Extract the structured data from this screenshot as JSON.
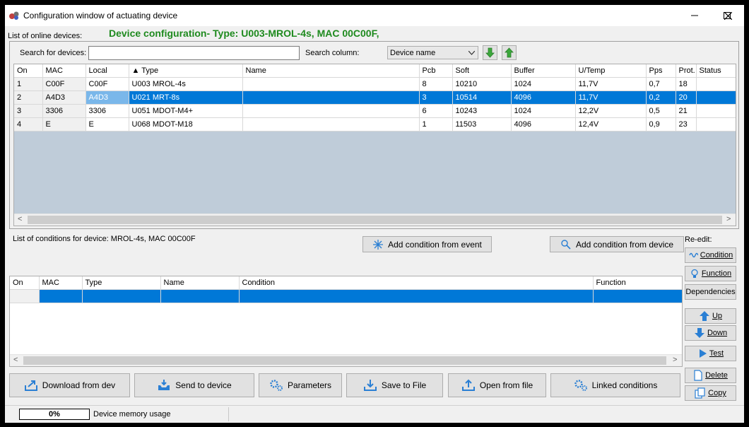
{
  "window": {
    "title": "Configuration window of actuating device",
    "minimize": "—",
    "maximize": "☐",
    "close": "✕"
  },
  "header": {
    "online_devices_label": "List of online devices:",
    "device_configuration": "Device configuration- Type: U003-MROL-4s, MAC 00C00F,"
  },
  "search": {
    "label": "Search for devices:",
    "value": "",
    "column_label": "Search column:",
    "column_value": "Device name"
  },
  "devices_table": {
    "columns": [
      "On",
      "MAC",
      "Local",
      "▲ Type",
      "Name",
      "Pcb",
      "Soft",
      "Buffer",
      "U/Temp",
      "Pps",
      "Prot.",
      "Status"
    ],
    "rows": [
      [
        "1",
        "C00F",
        "C00F",
        "U003 MROL-4s",
        "",
        "8",
        "10210",
        "1024",
        "11,7V",
        "0,7",
        "18",
        ""
      ],
      [
        "2",
        "A4D3",
        "A4D3",
        "U021 MRT-8s",
        "",
        "3",
        "10514",
        "4096",
        "11,7V",
        "0,2",
        "20",
        ""
      ],
      [
        "3",
        "3306",
        "3306",
        "U051 MDOT-M4+",
        "",
        "6",
        "10243",
        "1024",
        "12,2V",
        "0,5",
        "21",
        ""
      ],
      [
        "4",
        "E",
        "E",
        "U068 MDOT-M18",
        "",
        "1",
        "11503",
        "4096",
        "12,4V",
        "0,9",
        "23",
        ""
      ]
    ],
    "selected_row": 1
  },
  "conditions": {
    "list_label": "List of conditions for device: MROL-4s, MAC 00C00F",
    "add_from_event": "Add condition from event",
    "add_from_device": "Add condition from device",
    "columns": [
      "On",
      "MAC",
      "Type",
      "Name",
      "Condition",
      "Function"
    ],
    "rows": [
      [
        "",
        "",
        "",
        "",
        "",
        ""
      ]
    ]
  },
  "side_panel": {
    "re_edit_label": "Re-edit:",
    "condition": "Condition",
    "function": "Function",
    "dependencies": "Dependencies",
    "up": "Up",
    "down": "Down",
    "test": "Test",
    "delete": "Delete",
    "copy": "Copy"
  },
  "bottom_buttons": {
    "download": "Download from dev",
    "send": "Send to device",
    "parameters": "Parameters",
    "save": "Save to File",
    "open": "Open from file",
    "linked": "Linked conditions"
  },
  "status_bar": {
    "progress_text": "0%",
    "progress_value": 0,
    "memory_label": "Device memory usage"
  },
  "colors": {
    "selection": "#0078d7",
    "header_green": "#1e8a1e",
    "arrow_green": "#3ca83c",
    "icon_blue": "#2a7fd4"
  },
  "icons": {
    "app": "gear-app-icon",
    "sort_down": "arrow-down-icon",
    "sort_up": "arrow-up-icon",
    "event": "sparkle-icon",
    "device": "pointer-icon",
    "condition": "wave-icon",
    "function": "bulb-icon",
    "up": "arrow-up-icon",
    "down": "arrow-down-icon",
    "test": "play-icon",
    "delete": "document-icon",
    "copy": "copy-icon",
    "download": "upload-arrow-icon",
    "send": "tray-icon",
    "parameters": "gears-icon",
    "save": "save-arrow-icon",
    "open": "open-arrow-icon",
    "linked": "gears-icon"
  }
}
